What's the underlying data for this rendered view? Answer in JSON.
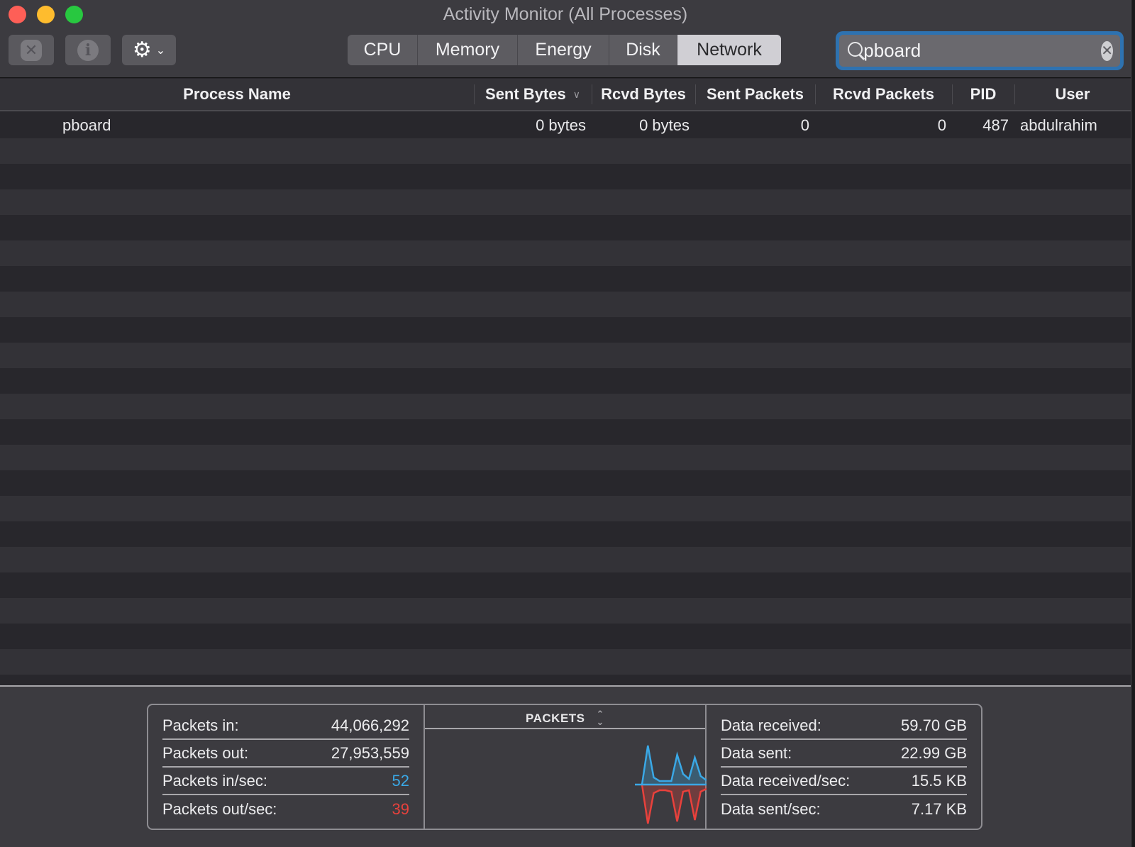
{
  "window": {
    "title": "Activity Monitor (All Processes)"
  },
  "toolbar": {
    "stop_icon": "stop-process-icon",
    "info_icon": "info-icon",
    "gear_icon": "gear-icon",
    "tabs": [
      {
        "label": "CPU",
        "active": false
      },
      {
        "label": "Memory",
        "active": false
      },
      {
        "label": "Energy",
        "active": false
      },
      {
        "label": "Disk",
        "active": false
      },
      {
        "label": "Network",
        "active": true
      }
    ],
    "search": {
      "value": "pboard",
      "placeholder": "Search"
    }
  },
  "table": {
    "columns": [
      "Process Name",
      "Sent Bytes",
      "Rcvd Bytes",
      "Sent Packets",
      "Rcvd Packets",
      "PID",
      "User"
    ],
    "sort_column": "Sent Bytes",
    "sort_direction": "descending",
    "rows": [
      {
        "process_name": "pboard",
        "sent_bytes": "0 bytes",
        "rcvd_bytes": "0 bytes",
        "sent_packets": "0",
        "rcvd_packets": "0",
        "pid": "487",
        "user": "abdulrahim"
      }
    ]
  },
  "stats": {
    "left": [
      {
        "label": "Packets in:",
        "value": "44,066,292"
      },
      {
        "label": "Packets out:",
        "value": "27,953,559"
      },
      {
        "label": "Packets in/sec:",
        "value": "52"
      },
      {
        "label": "Packets out/sec:",
        "value": "39"
      }
    ],
    "chart_title": "PACKETS",
    "right": [
      {
        "label": "Data received:",
        "value": "59.70 GB"
      },
      {
        "label": "Data sent:",
        "value": "22.99 GB"
      },
      {
        "label": "Data received/sec:",
        "value": "15.5 KB"
      },
      {
        "label": "Data sent/sec:",
        "value": "7.17 KB"
      }
    ]
  },
  "colors": {
    "in_series": "#3aa8e6",
    "out_series": "#e8413c",
    "accent": "#2e72b0"
  },
  "chart_data": {
    "type": "area",
    "title": "PACKETS",
    "series": [
      {
        "name": "Packets in/sec",
        "values": [
          0,
          55,
          10,
          5,
          5,
          5,
          42,
          15,
          8,
          38,
          12,
          6
        ]
      },
      {
        "name": "Packets out/sec",
        "values": [
          0,
          55,
          12,
          8,
          8,
          10,
          52,
          10,
          8,
          50,
          10,
          6
        ]
      }
    ]
  }
}
